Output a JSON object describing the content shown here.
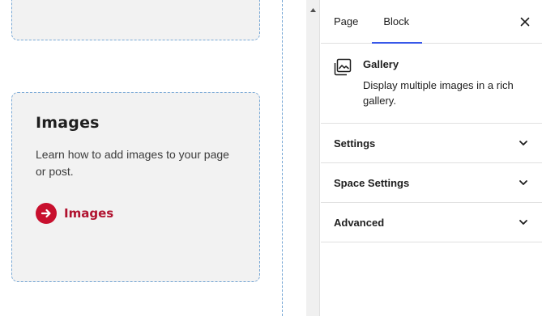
{
  "canvas": {
    "card": {
      "title": "Images",
      "description": "Learn how to add images to your page or post.",
      "link_label": "Images"
    }
  },
  "sidebar": {
    "tabs": [
      {
        "label": "Page",
        "active": false
      },
      {
        "label": "Block",
        "active": true
      }
    ],
    "block": {
      "name": "Gallery",
      "description": "Display multiple images in a rich gallery.",
      "icon": "gallery-icon"
    },
    "panels": [
      {
        "label": "Settings",
        "icon": "chevron-down-icon"
      },
      {
        "label": "Space Settings",
        "icon": "chevron-down-icon"
      },
      {
        "label": "Advanced",
        "icon": "chevron-down-icon"
      }
    ]
  },
  "colors": {
    "accent": "#3858e9",
    "brand_red": "#c8102e",
    "card_bg": "#f2f2f2",
    "guide_dashed": "#7aa9d6"
  }
}
